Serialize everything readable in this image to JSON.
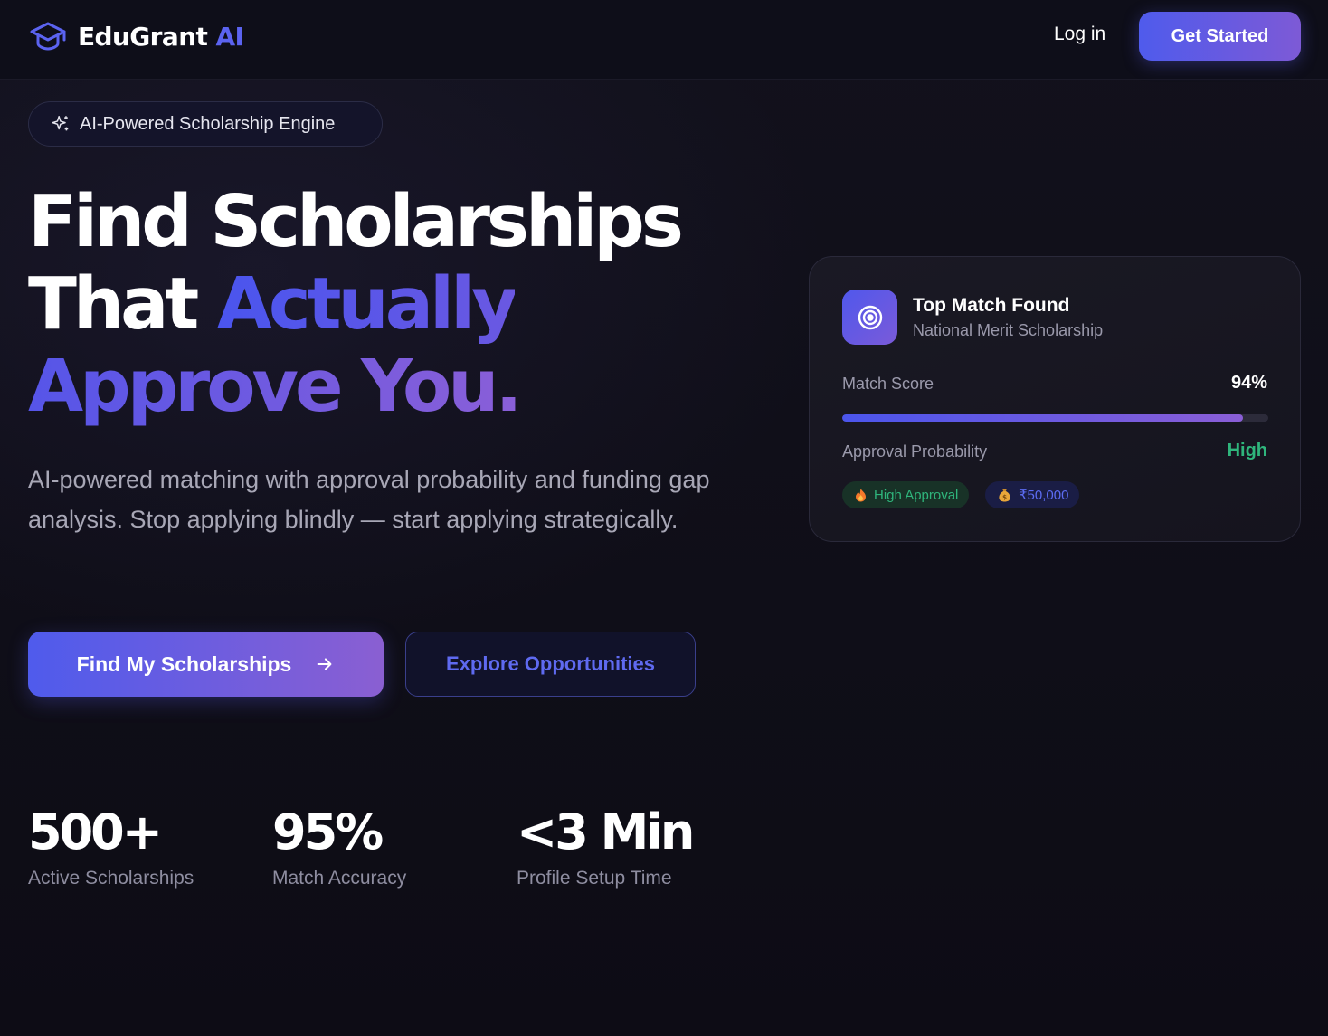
{
  "header": {
    "brand_main": "EduGrant",
    "brand_accent": "AI",
    "logo_icon": "graduation-cap-icon",
    "login_label": "Log in",
    "cta_label": "Get Started"
  },
  "hero": {
    "pill_label": "AI-Powered Scholarship Engine",
    "pill_icon": "sparkles-icon",
    "headline_line1": "Find Scholarships",
    "headline_line2_plain": "That",
    "headline_line2_accent": "Actually",
    "headline_line3": "Approve You.",
    "subtitle": "AI-powered matching with approval probability and funding gap analysis. Stop applying blindly — start applying strategically.",
    "primary_button": "Find My Scholarships",
    "secondary_button": "Explore Opportunities"
  },
  "stats": [
    {
      "value": "500+",
      "label": "Active Scholarships"
    },
    {
      "value": "95%",
      "label": "Match Accuracy"
    },
    {
      "value": "<3 Min",
      "label": "Profile Setup Time"
    }
  ],
  "match_card": {
    "icon": "target-icon",
    "title": "Top Match Found",
    "subtitle": "National Merit Scholarship",
    "match_score_label": "Match Score",
    "match_score_value": "94%",
    "match_score_fraction": 0.94,
    "approval_label": "Approval Probability",
    "approval_value": "High",
    "badges": [
      {
        "icon": "fire-icon",
        "label": "High Approval"
      },
      {
        "icon": "money-bag-icon",
        "label": "₹50,000"
      }
    ]
  },
  "colors": {
    "accent": "#5b63f0",
    "accent_purple": "#8a5fd8",
    "success": "#2fb57c",
    "background": "#0e0d16"
  }
}
